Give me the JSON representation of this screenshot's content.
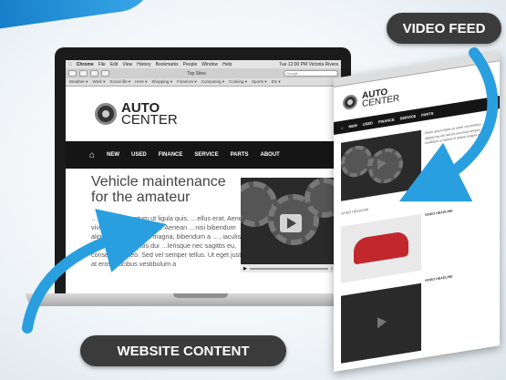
{
  "badges": {
    "video_feed": "VIDEO FEED",
    "website_content": "WEBSITE CONTENT"
  },
  "browser": {
    "menu": [
      "Chrome",
      "File",
      "Edit",
      "View",
      "History",
      "Bookmarks",
      "People",
      "Window",
      "Help"
    ],
    "clock": "Tue 12:00 PM  Victoria Rivera",
    "tab_title": "Top Sites",
    "search_placeholder": "Google",
    "bookmarks": [
      "Weather ▾",
      "Work ▾",
      "Social life ▾",
      "Here ▾",
      "Shopping ▾",
      "Finances ▾",
      "Computing ▾",
      "Cooking ▾",
      "Sports ▾",
      "Etc ▾"
    ]
  },
  "site": {
    "logo_top": "AUTO",
    "logo_bottom": "CENTER",
    "nav": [
      "NEW",
      "USED",
      "FINANCE",
      "SERVICE",
      "PARTS",
      "ABOUT"
    ],
    "headline": "Vehicle maintenance for the amateur",
    "body": "…te dui, fermentum ut ligula quis, …ellus erat. Aenean viverra …liquet pharetra. Aenean …nisi bibendum aliquam. Pel… …dui magna, bibendum a …, iaculis maximus eros. Duis dui …lerisque nec sagittis eu, conse… …n leo. Sed vel semper tellus. Ut eget justo at eros faucibus vestibulum a"
  },
  "tablet": {
    "nav": [
      "NEW",
      "USED",
      "FINANCE",
      "SERVICE",
      "PARTS"
    ],
    "section_heading_1": "VIDEO HEADLINE",
    "section_heading_2": "VIDEO HEADLINE",
    "section_heading_3": "VIDEO HEADLINE"
  },
  "colors": {
    "accent": "#2a9fe0",
    "dark": "#151515",
    "pill": "#3b3b3b"
  }
}
